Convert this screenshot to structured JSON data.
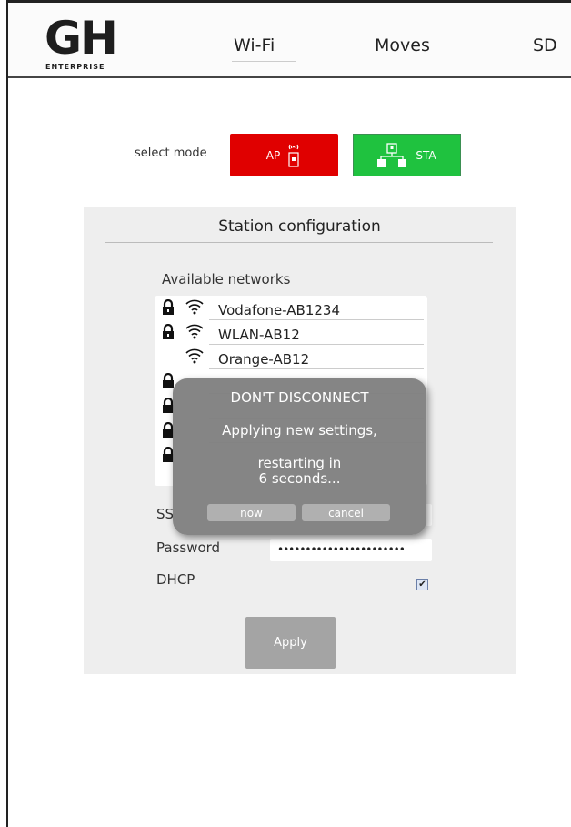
{
  "header": {
    "logo_text": "GH",
    "logo_subtext": "ENTERPRISE",
    "nav": [
      {
        "label": "Wi-Fi",
        "active": true
      },
      {
        "label": "Moves"
      },
      {
        "label": "SD"
      }
    ]
  },
  "mode": {
    "label": "select mode",
    "ap_label": "AP",
    "sta_label": "STA",
    "ap_color": "#e00000",
    "sta_color": "#1fc23f",
    "selected": "STA"
  },
  "station": {
    "title": "Station configuration",
    "available_label": "Available networks",
    "networks": [
      {
        "name": "Vodafone-AB1234",
        "locked": true
      },
      {
        "name": "WLAN-AB12",
        "locked": true
      },
      {
        "name": "Orange-AB12",
        "locked": false
      },
      {
        "name": "",
        "locked": true
      },
      {
        "name": "",
        "locked": true
      },
      {
        "name": "",
        "locked": true
      },
      {
        "name": "",
        "locked": true
      }
    ],
    "ssid_label": "SS",
    "password_label": "Password",
    "password_value": "•••••••••••••••••••••••",
    "dhcp_label": "DHCP",
    "dhcp_checked": true,
    "apply_label": "Apply"
  },
  "modal": {
    "title": "DON'T DISCONNECT",
    "line1": "Applying new settings,",
    "line2a": "restarting in",
    "line2b": "6 seconds...",
    "now_label": "now",
    "cancel_label": "cancel"
  }
}
